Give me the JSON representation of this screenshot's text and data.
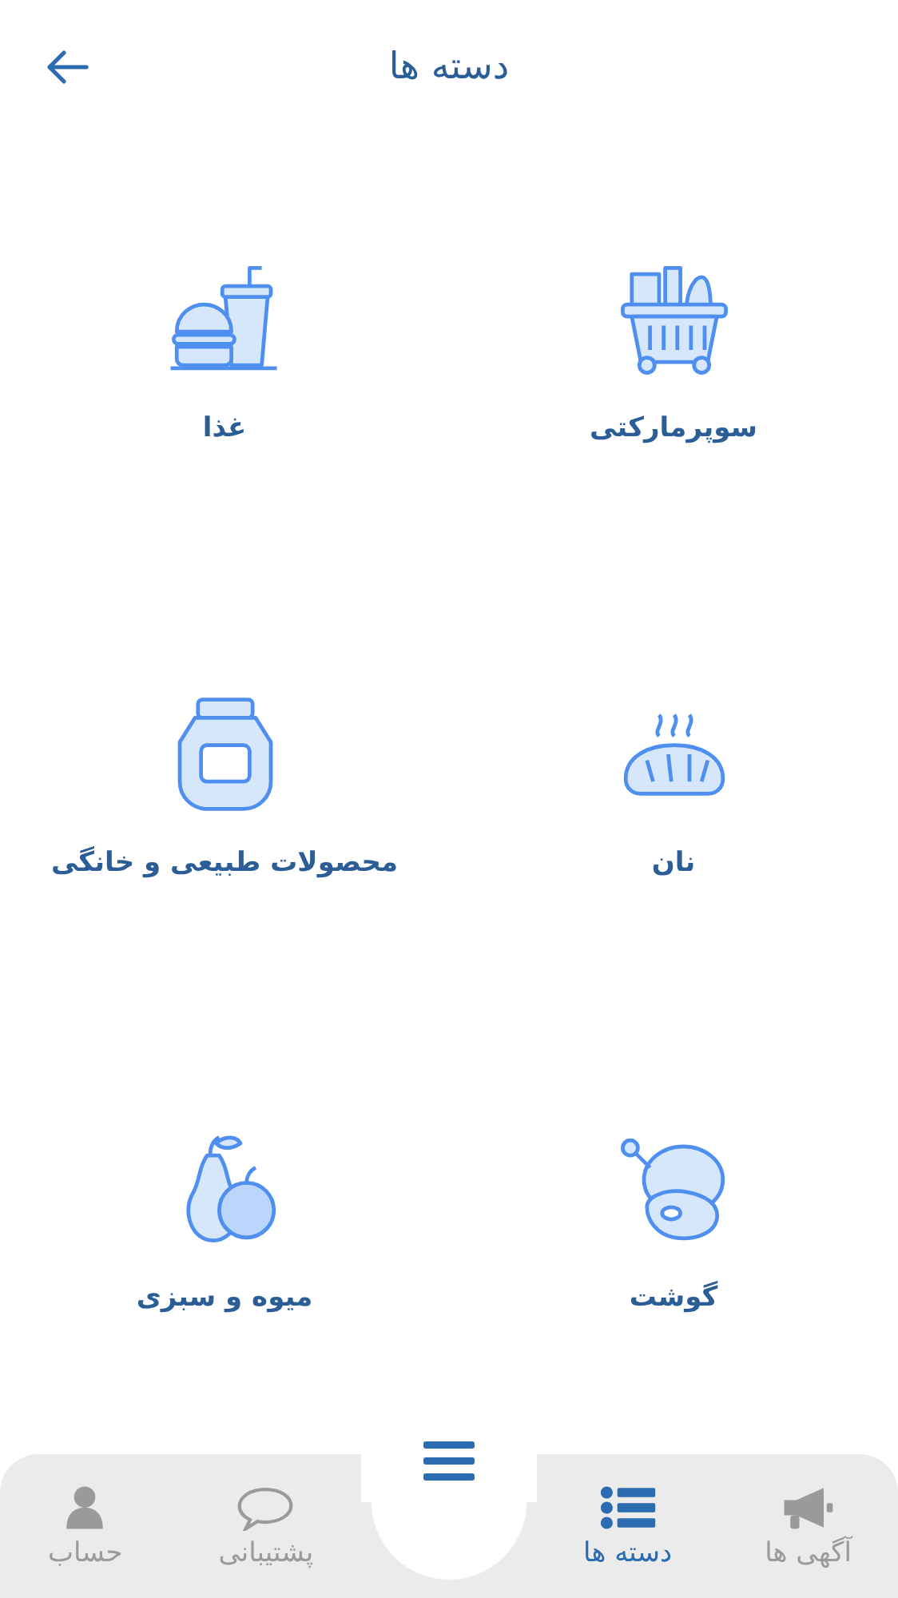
{
  "header": {
    "title": "دسته ها"
  },
  "categories": [
    {
      "label": "سوپرمارکتی",
      "kind": "basket"
    },
    {
      "label": "غذا",
      "kind": "fastfood"
    },
    {
      "label": "نان",
      "kind": "bread"
    },
    {
      "label": "محصولات طبیعی و خانگی",
      "kind": "jar"
    },
    {
      "label": "گوشت",
      "kind": "meat"
    },
    {
      "label": "میوه و سبزی",
      "kind": "fruit"
    }
  ],
  "nav": [
    {
      "label": "آگهی ها",
      "kind": "megaphone",
      "selected": false
    },
    {
      "label": "دسته ها",
      "kind": "list",
      "selected": true
    },
    {
      "label": "پشتیبانی",
      "kind": "chat",
      "selected": false
    },
    {
      "label": "حساب",
      "kind": "person",
      "selected": false
    }
  ]
}
